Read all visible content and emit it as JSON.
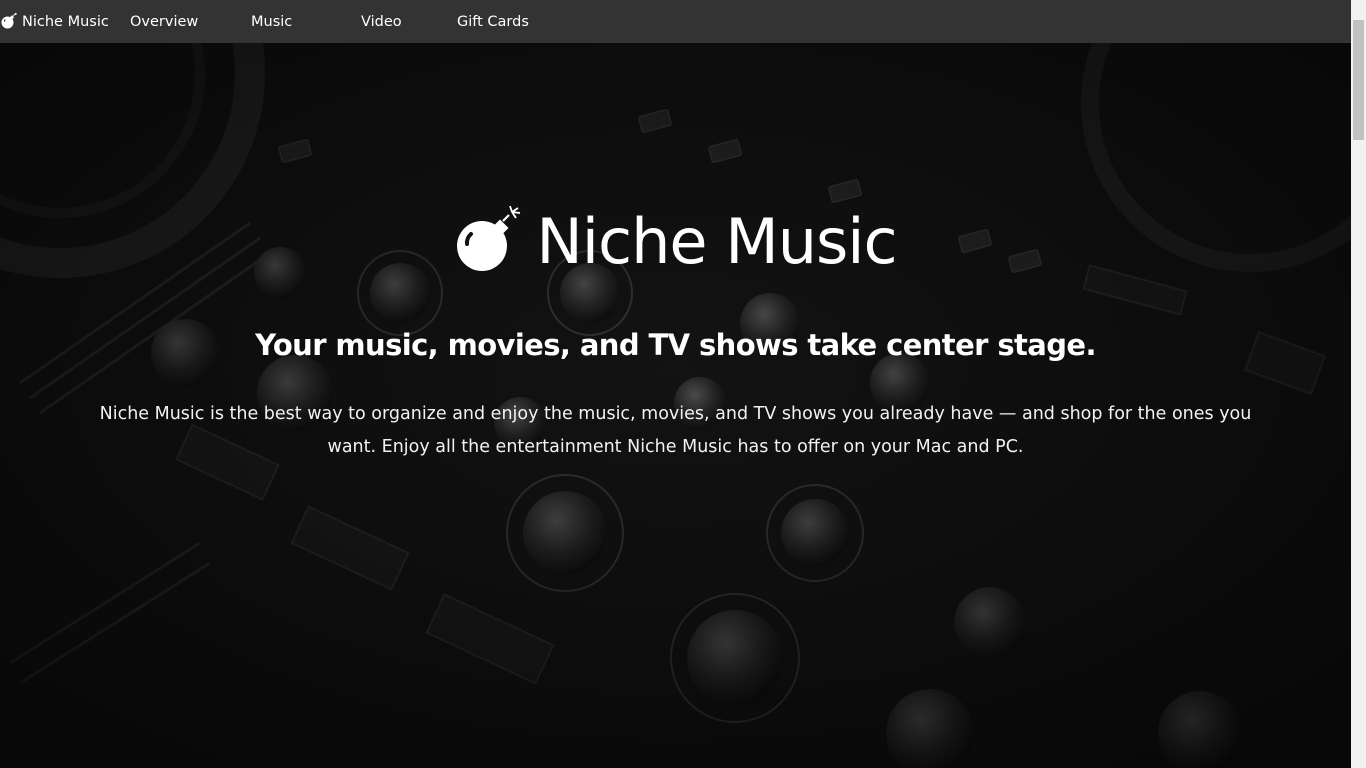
{
  "nav": {
    "brand_icon": "bomb-icon",
    "brand_label": "Niche Music",
    "items": [
      {
        "label": "Overview"
      },
      {
        "label": "Music"
      },
      {
        "label": "Video"
      },
      {
        "label": "Gift Cards"
      }
    ]
  },
  "hero": {
    "icon": "bomb-icon",
    "title": "Niche Music",
    "subtitle": "Your music, movies, and TV shows take center stage.",
    "body": "Niche Music is the best way to organize and enjoy the music, movies, and TV shows you already have — and shop for the ones you want. Enjoy all the entertainment Niche Music has to offer on your Mac and PC.",
    "background": "dj-mixer-photo"
  },
  "colors": {
    "navbar": "#333333",
    "text": "#ffffff",
    "hero_bg": "#121212"
  }
}
